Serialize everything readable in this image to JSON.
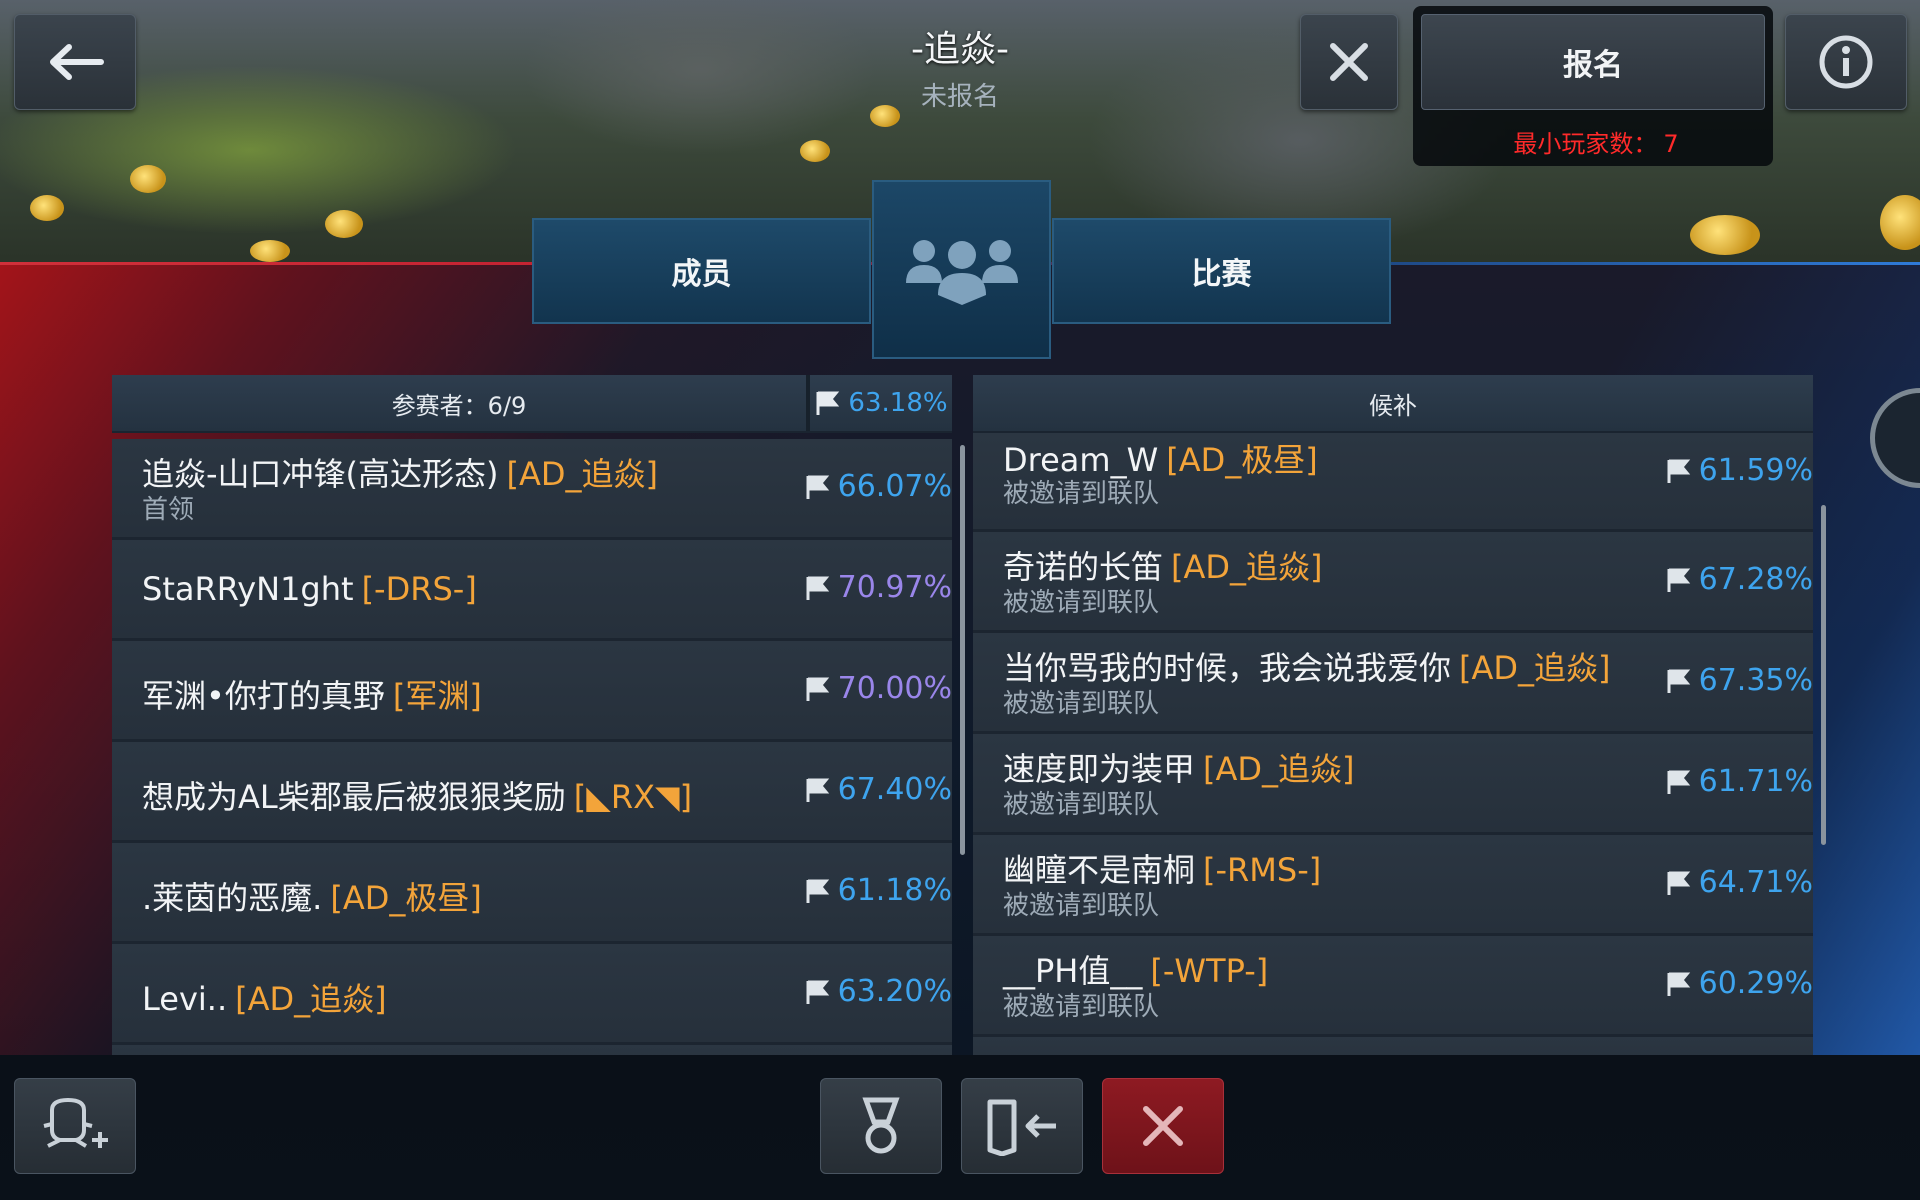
{
  "header": {
    "title": "-追焱-",
    "status": "未报名",
    "signup_label": "报名",
    "min_players_label": "最小玩家数：",
    "min_players_value": "7"
  },
  "tabs": {
    "members": "成员",
    "battles": "比赛"
  },
  "participants": {
    "header_label": "参赛者：6/9",
    "header_rate": "63.18%",
    "rows": [
      {
        "name": "追焱-山口冲锋(高达形态)",
        "clan": "[AD_追焱]",
        "sub": "首领",
        "rate": "66.07%"
      },
      {
        "name": "StaRRyN1ght",
        "clan": "[-DRS-]",
        "sub": "",
        "rate": "70.97%"
      },
      {
        "name": "军渊•你打的真野",
        "clan": "[军渊]",
        "sub": "",
        "rate": "70.00%"
      },
      {
        "name": "想成为AL柴郡最后被狠狠奖励",
        "clan": "[◣RX◥]",
        "sub": "",
        "rate": "67.40%"
      },
      {
        "name": ".莱茵的恶魔.",
        "clan": "[AD_极昼]",
        "sub": "",
        "rate": "61.18%"
      },
      {
        "name": "Levi..",
        "clan": "[AD_追焱]",
        "sub": "",
        "rate": "63.20%"
      }
    ]
  },
  "reserve": {
    "header_label": "候补",
    "rows": [
      {
        "name": "Dream_W",
        "clan": "[AD_极昼]",
        "sub": "被邀请到联队",
        "rate": "61.59%"
      },
      {
        "name": "奇诺的长笛",
        "clan": "[AD_追焱]",
        "sub": "被邀请到联队",
        "rate": "67.28%"
      },
      {
        "name": "当你骂我的时候，我会说我爱你",
        "clan": "[AD_追焱]",
        "sub": "被邀请到联队",
        "rate": "67.35%"
      },
      {
        "name": "速度即为装甲",
        "clan": "[AD_追焱]",
        "sub": "被邀请到联队",
        "rate": "61.71%"
      },
      {
        "name": "幽瞳不是南桐",
        "clan": "[-RMS-]",
        "sub": "被邀请到联队",
        "rate": "64.71%"
      },
      {
        "name": "__PH值__",
        "clan": "[-WTP-]",
        "sub": "被邀请到联队",
        "rate": "60.29%"
      }
    ]
  },
  "colors": {
    "clan_tag": "#f3a43a",
    "rate_blue": "#3ea4ee",
    "rate_purple": "#9a86ea",
    "min_players_red": "#ff2a2a",
    "tab_blue": "#1e4a6a"
  },
  "icons": {
    "back": "arrow-left-icon",
    "close": "close-icon",
    "info": "info-icon",
    "members": "group-icon",
    "flag": "flag-icon",
    "invite": "add-member-icon",
    "medal": "medal-icon",
    "leave": "leave-icon",
    "disband": "close-icon"
  }
}
